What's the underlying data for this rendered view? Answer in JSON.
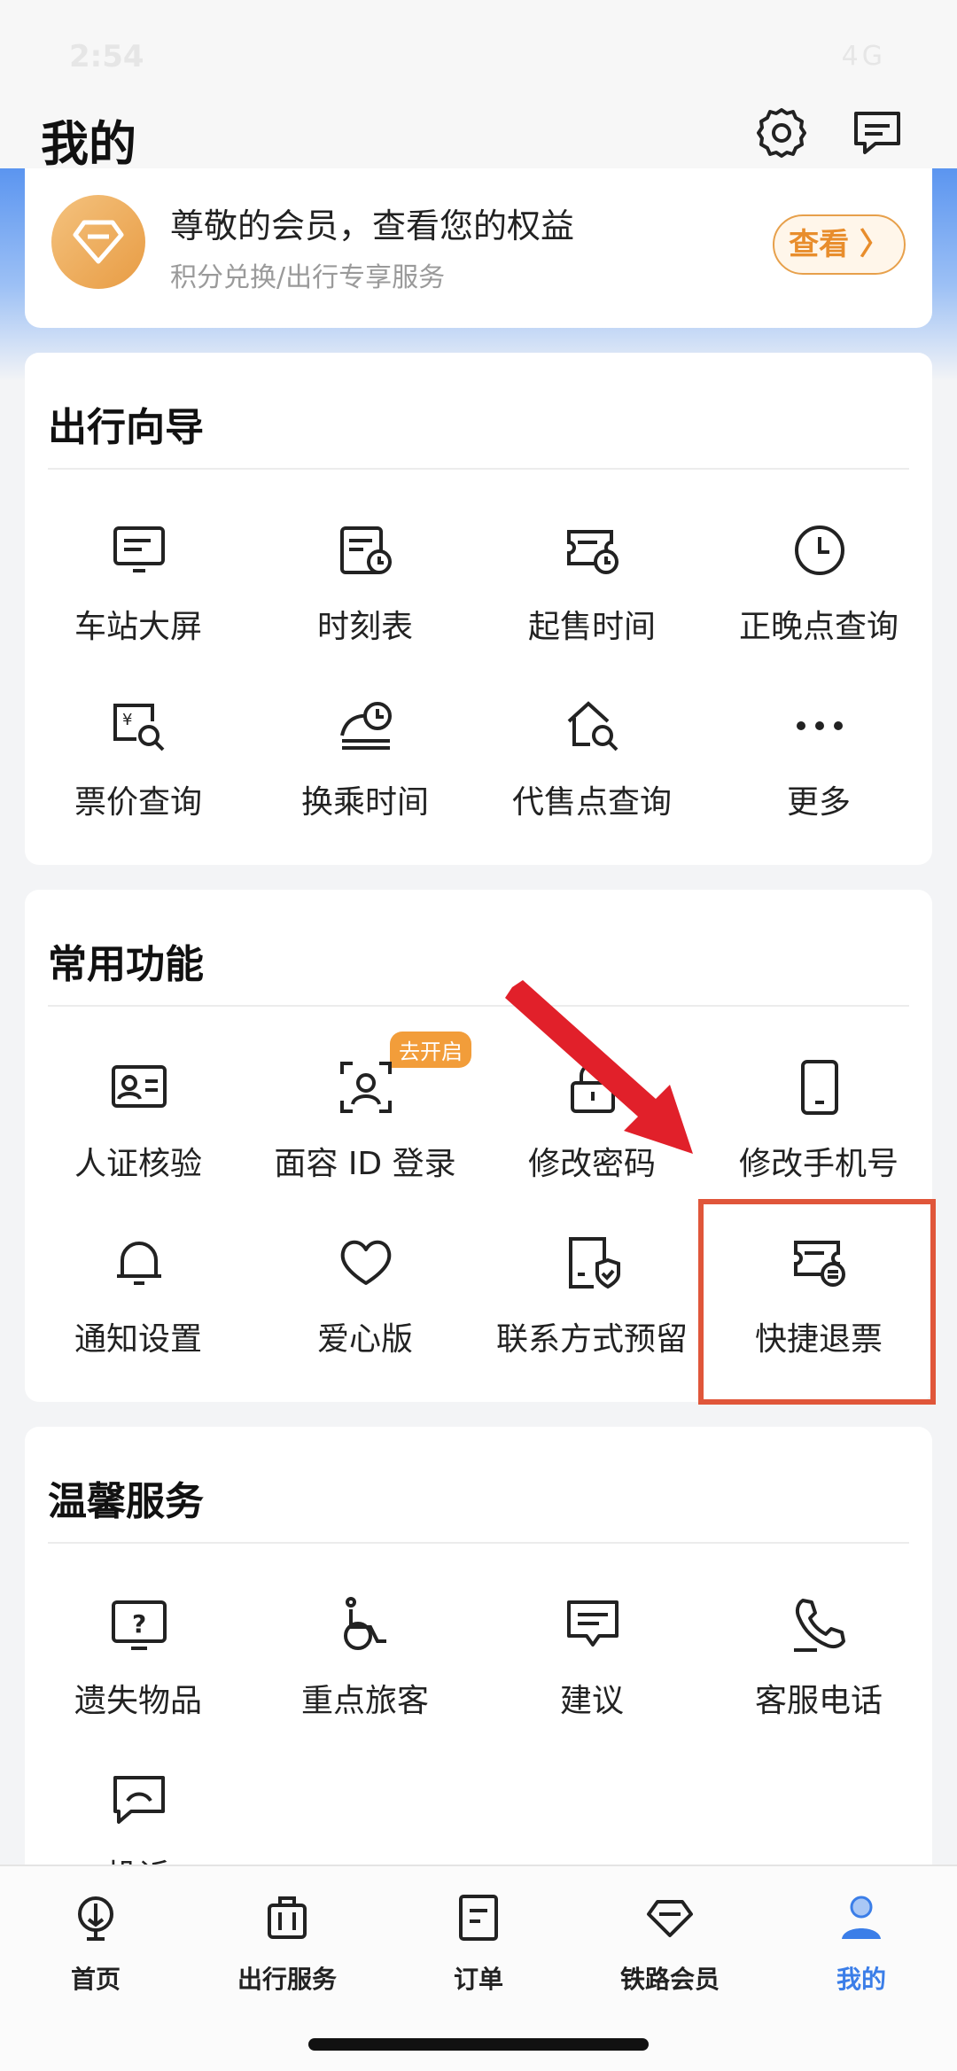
{
  "status_bar": {
    "time": "2:54",
    "network": "4G"
  },
  "header": {
    "title": "我的"
  },
  "member_card": {
    "title": "尊敬的会员，查看您的权益",
    "subtitle": "积分兑换/出行专享服务",
    "button_label": "查看 〉"
  },
  "travel_guide": {
    "title": "出行向导",
    "items": [
      {
        "label": "车站大屏",
        "icon": "station-screen-icon"
      },
      {
        "label": "时刻表",
        "icon": "timetable-icon"
      },
      {
        "label": "起售时间",
        "icon": "sale-time-icon"
      },
      {
        "label": "正晚点查询",
        "icon": "clock-icon"
      },
      {
        "label": "票价查询",
        "icon": "fare-search-icon"
      },
      {
        "label": "换乘时间",
        "icon": "transfer-time-icon"
      },
      {
        "label": "代售点查询",
        "icon": "agency-search-icon"
      },
      {
        "label": "更多",
        "icon": "more-icon"
      }
    ]
  },
  "common_functions": {
    "title": "常用功能",
    "badge": "去开启",
    "items": [
      {
        "label": "人证核验",
        "icon": "id-card-icon"
      },
      {
        "label": "面容 ID 登录",
        "icon": "face-id-icon"
      },
      {
        "label": "修改密码",
        "icon": "lock-icon"
      },
      {
        "label": "修改手机号",
        "icon": "phone-icon"
      },
      {
        "label": "通知设置",
        "icon": "bell-icon"
      },
      {
        "label": "爱心版",
        "icon": "heart-icon"
      },
      {
        "label": "联系方式预留",
        "icon": "contact-shield-icon"
      },
      {
        "label": "快捷退票",
        "icon": "quick-refund-icon"
      }
    ]
  },
  "warm_service": {
    "title": "温馨服务",
    "items": [
      {
        "label": "遗失物品",
        "icon": "lost-item-icon"
      },
      {
        "label": "重点旅客",
        "icon": "wheelchair-icon"
      },
      {
        "label": "建议",
        "icon": "suggestion-icon"
      },
      {
        "label": "客服电话",
        "icon": "phone-call-icon"
      },
      {
        "label": "投诉",
        "icon": "complaint-icon"
      }
    ]
  },
  "tab_bar": {
    "items": [
      {
        "label": "首页",
        "icon": "home-icon"
      },
      {
        "label": "出行服务",
        "icon": "luggage-icon"
      },
      {
        "label": "订单",
        "icon": "order-icon"
      },
      {
        "label": "铁路会员",
        "icon": "diamond-icon"
      },
      {
        "label": "我的",
        "icon": "user-icon",
        "active": true
      }
    ]
  },
  "colors": {
    "accent": "#3b7ee8",
    "highlight": "#e0563a",
    "member_gold": "#e89c44"
  }
}
